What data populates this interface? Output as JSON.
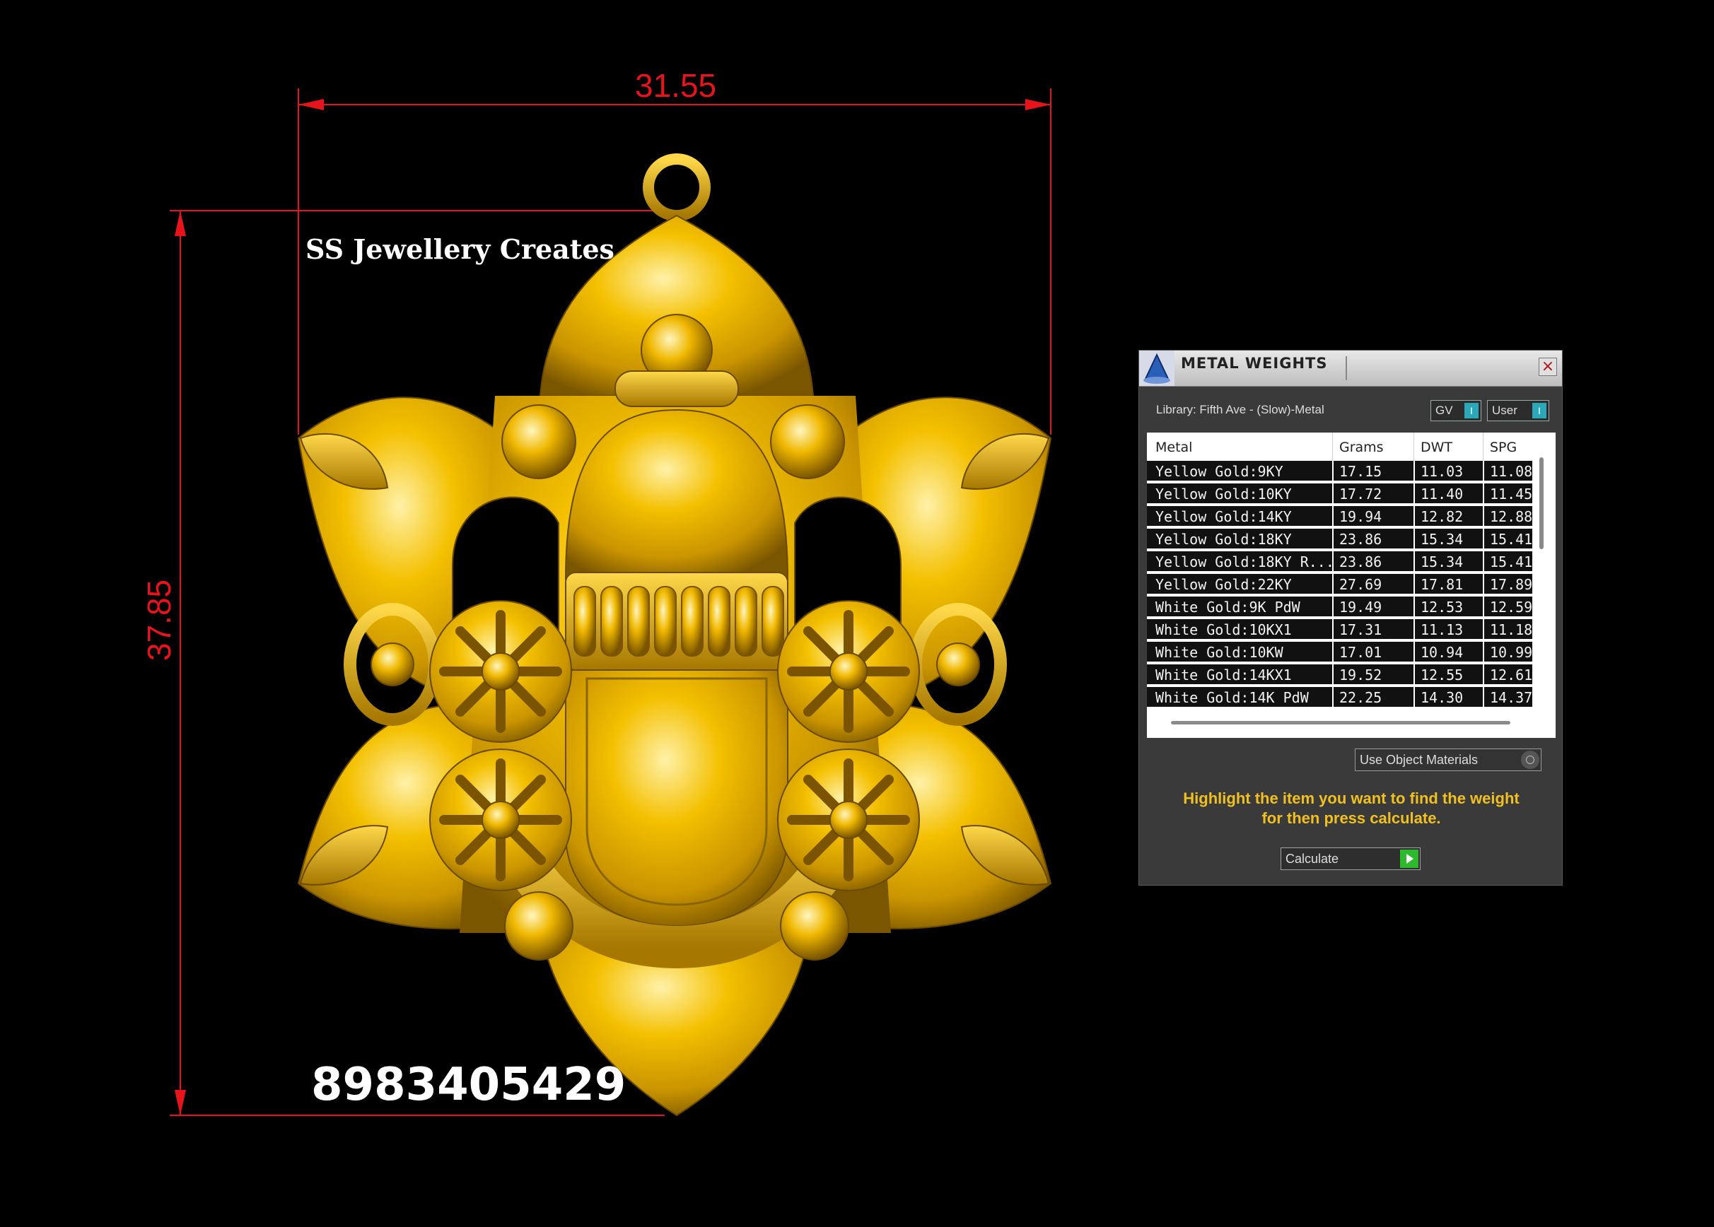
{
  "viewport": {
    "dimension_width": "31.55",
    "dimension_height": "37.85",
    "brand_text": "SS Jewellery Creates",
    "phone_text": "8983405429",
    "dimension_color": "#e8141c",
    "metal_color": "#f0b800"
  },
  "dialog": {
    "title": "METAL WEIGHTS",
    "close_glyph": "×",
    "library_label": "Library: Fifth Ave - (Slow)-Metal",
    "gv_toggle": "GV",
    "user_toggle": "User",
    "columns": [
      "Metal",
      "Grams",
      "DWT",
      "SPG"
    ],
    "rows": [
      [
        "Yellow Gold:9KY",
        "17.15",
        "11.03",
        "11.08"
      ],
      [
        "Yellow Gold:10KY",
        "17.72",
        "11.40",
        "11.45"
      ],
      [
        "Yellow Gold:14KY",
        "19.94",
        "12.82",
        "12.88"
      ],
      [
        "Yellow Gold:18KY",
        "23.86",
        "15.34",
        "15.41"
      ],
      [
        "Yellow Gold:18KY R...",
        "23.86",
        "15.34",
        "15.41"
      ],
      [
        "Yellow Gold:22KY",
        "27.69",
        "17.81",
        "17.89"
      ],
      [
        "White Gold:9K PdW",
        "19.49",
        "12.53",
        "12.59"
      ],
      [
        "White Gold:10KX1",
        "17.31",
        "11.13",
        "11.18"
      ],
      [
        "White Gold:10KW",
        "17.01",
        "10.94",
        "10.99"
      ],
      [
        "White Gold:14KX1",
        "19.52",
        "12.55",
        "12.61"
      ],
      [
        "White Gold:14K PdW",
        "22.25",
        "14.30",
        "14.37"
      ]
    ],
    "materials_select": "Use Object Materials",
    "instructions_line1": "Highlight the item you want to find the weight",
    "instructions_line2": "for then press calculate.",
    "calculate_label": "Calculate",
    "accent_color": "#2aa8b8",
    "go_color": "#2eb82e",
    "instruction_color": "#f0c020"
  }
}
